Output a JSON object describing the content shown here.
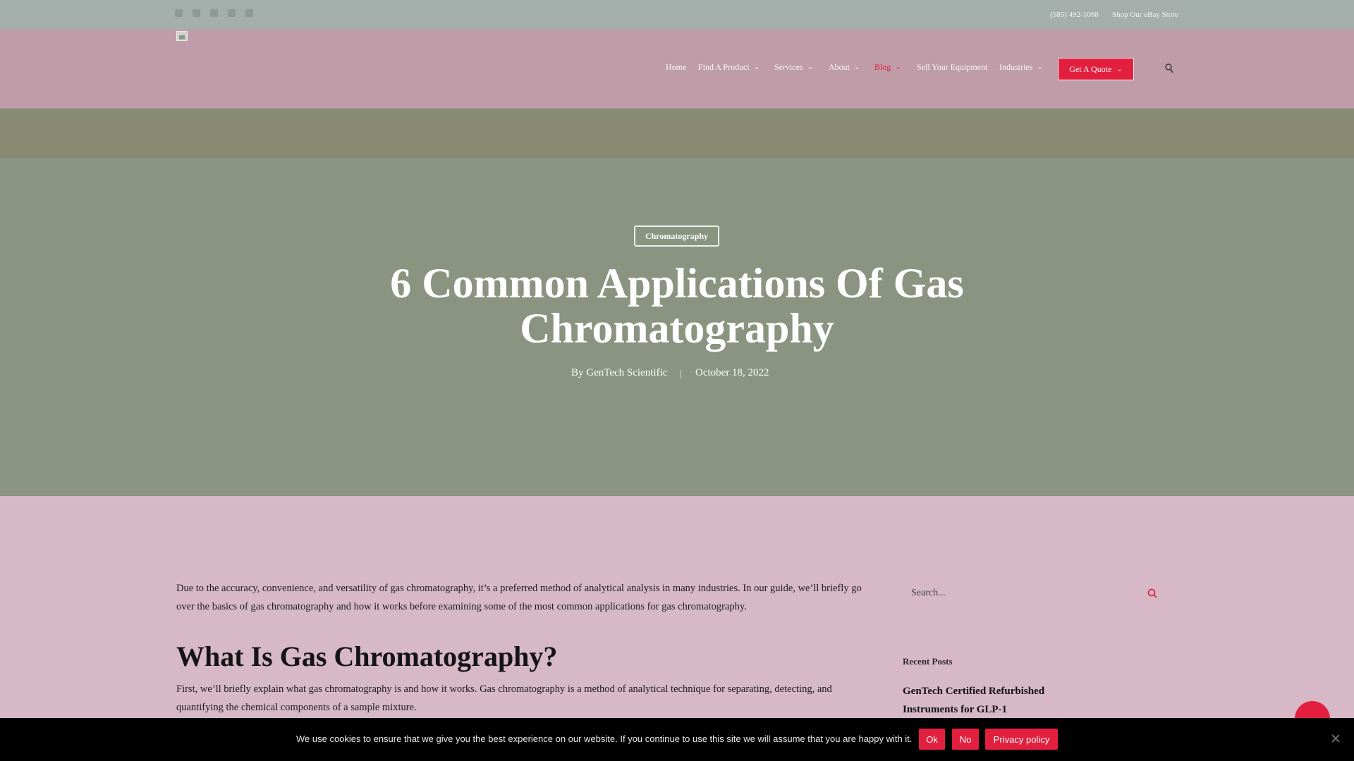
{
  "topbar": {
    "social_icons": [
      "facebook-icon",
      "twitter-icon",
      "linkedin-icon",
      "instagram-icon",
      "youtube-icon"
    ],
    "phone": "(585) 492-1068",
    "ebay_link": "Shop Our eBay Store"
  },
  "nav": {
    "items": [
      {
        "label": "Home",
        "dropdown": false
      },
      {
        "label": "Find A Product",
        "dropdown": true
      },
      {
        "label": "Services",
        "dropdown": true
      },
      {
        "label": "About",
        "dropdown": true
      },
      {
        "label": "Blog",
        "dropdown": true,
        "active": true
      },
      {
        "label": "Sell Your Equipment",
        "dropdown": false
      },
      {
        "label": "Industries",
        "dropdown": true
      }
    ],
    "cta": "Get A Quote",
    "search_icon": "search-icon"
  },
  "hero": {
    "category": "Chromatography",
    "title": "6 Common Applications Of Gas Chromatography",
    "author": "By GenTech Scientific",
    "date": "October 18, 2022"
  },
  "article": {
    "intro": "Due to the accuracy, convenience, and versatility of gas chromatography, it’s a preferred method of analytical analysis in many industries. In our guide, we’ll briefly go over the basics of gas chromatography and how it works before examining some of the most common applications for gas chromatography.",
    "heading": "What Is Gas Chromatography?",
    "para": "First, we’ll briefly explain what gas chromatography is and how it works. Gas chromatography is a method of analytical technique for separating, detecting, and quantifying the chemical components of a sample mixture."
  },
  "sidebar": {
    "search_placeholder": "Search...",
    "recent_posts_title": "Recent Posts",
    "recent_post": "GenTech Certified Refurbished Instruments for GLP-1"
  },
  "cookie": {
    "text": "We use cookies to ensure that we give you the best experience on our website. If you continue to use this site we will assume that you are happy with it.",
    "ok": "Ok",
    "no": "No",
    "privacy": "Privacy policy"
  },
  "colors": {
    "accent": "#e21f3e",
    "hero_bg": "#8b9480",
    "page_bg": "#d6b8c6"
  }
}
